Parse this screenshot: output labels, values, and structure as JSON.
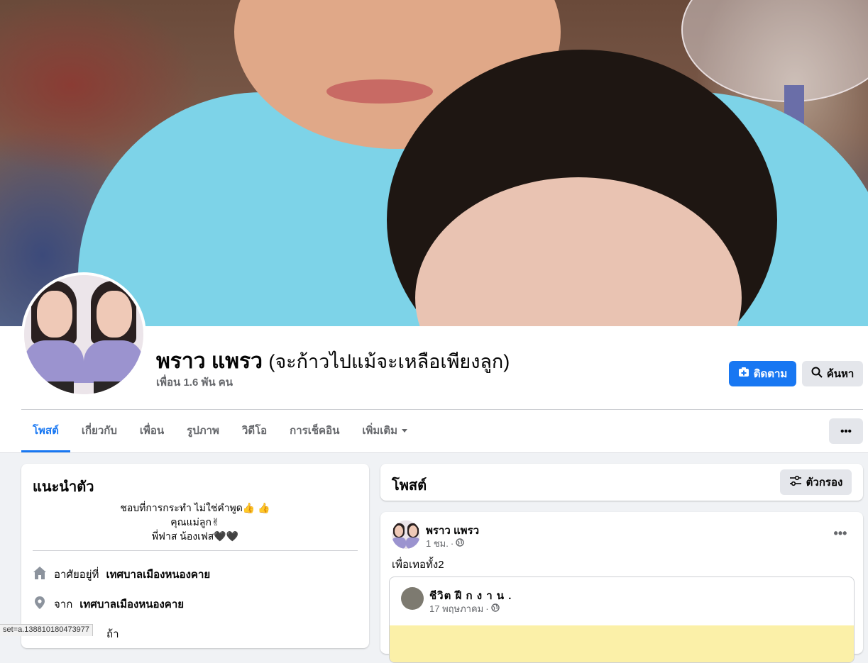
{
  "profile": {
    "name": "พราว แพรว",
    "alternate_name": "(จะก้าวไปแม้จะเหลือเพียงลูก)",
    "friends_count": "เพื่อน 1.6 พัน คน"
  },
  "actions": {
    "follow_label": "ติดตาม",
    "search_label": "ค้นหา",
    "more_label": "•••"
  },
  "tabs": [
    {
      "label": "โพสต์",
      "active": true
    },
    {
      "label": "เกี่ยวกับ"
    },
    {
      "label": "เพื่อน"
    },
    {
      "label": "รูปภาพ"
    },
    {
      "label": "วิดีโอ"
    },
    {
      "label": "การเช็คอิน"
    },
    {
      "label": "เพิ่มเติม"
    }
  ],
  "intro": {
    "title": "แนะนำตัว",
    "bio_lines": [
      "ชอบที่การกระทำ ไม่ใช่คำพูด👍 👍",
      "คุณแม่ลูก✌",
      "พี่ฟาส น้องเฟส🖤🖤"
    ],
    "lives_in_prefix": "อาศัยอยู่ที่",
    "lives_in_value": "เทศบาลเมืองหนองคาย",
    "from_prefix": "จาก",
    "from_value": "เทศบาลเมืองหนองคาย",
    "partial_row": "ถ้า"
  },
  "posts": {
    "title": "โพสต์",
    "filter_label": "ตัวกรอง"
  },
  "post": {
    "author": "พราว แพรว",
    "time": "1 ชม.",
    "text": "เพื่อเทอทั้ง2",
    "menu_label": "•••",
    "shared": {
      "author": "ชีวิต ฝี ก ง า น .",
      "date": "17 พฤษภาคม"
    }
  },
  "status_bar": {
    "url": "set=a.138810180473977"
  },
  "colors": {
    "accent": "#1877f2",
    "secondary_text": "#65676b",
    "background": "#f0f2f5"
  }
}
